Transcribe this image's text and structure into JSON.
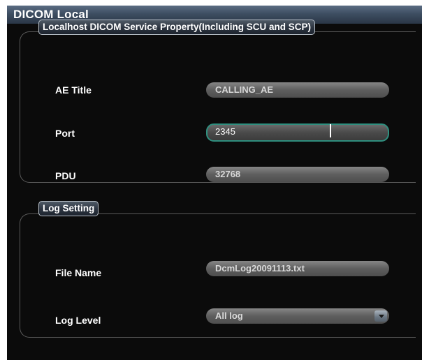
{
  "window": {
    "title": "DICOM Local"
  },
  "service_group": {
    "legend": "Localhost DICOM Service Property(Including SCU and SCP)",
    "ae_title": {
      "label": "AE Title",
      "value": "CALLING_AE"
    },
    "port": {
      "label": "Port",
      "value": "2345"
    },
    "pdu": {
      "label": "PDU",
      "value": "32768"
    }
  },
  "log_group": {
    "legend": "Log Setting",
    "file_name": {
      "label": "File Name",
      "value": "DcmLog20091113.txt"
    },
    "log_level": {
      "label": "Log Level",
      "value": "All log"
    }
  },
  "colors": {
    "title_bar": "#3e4e62",
    "panel_bg": "#0e0e0e",
    "field_gray": "#6a6a6a",
    "focus_border": "#2f8f7f"
  }
}
